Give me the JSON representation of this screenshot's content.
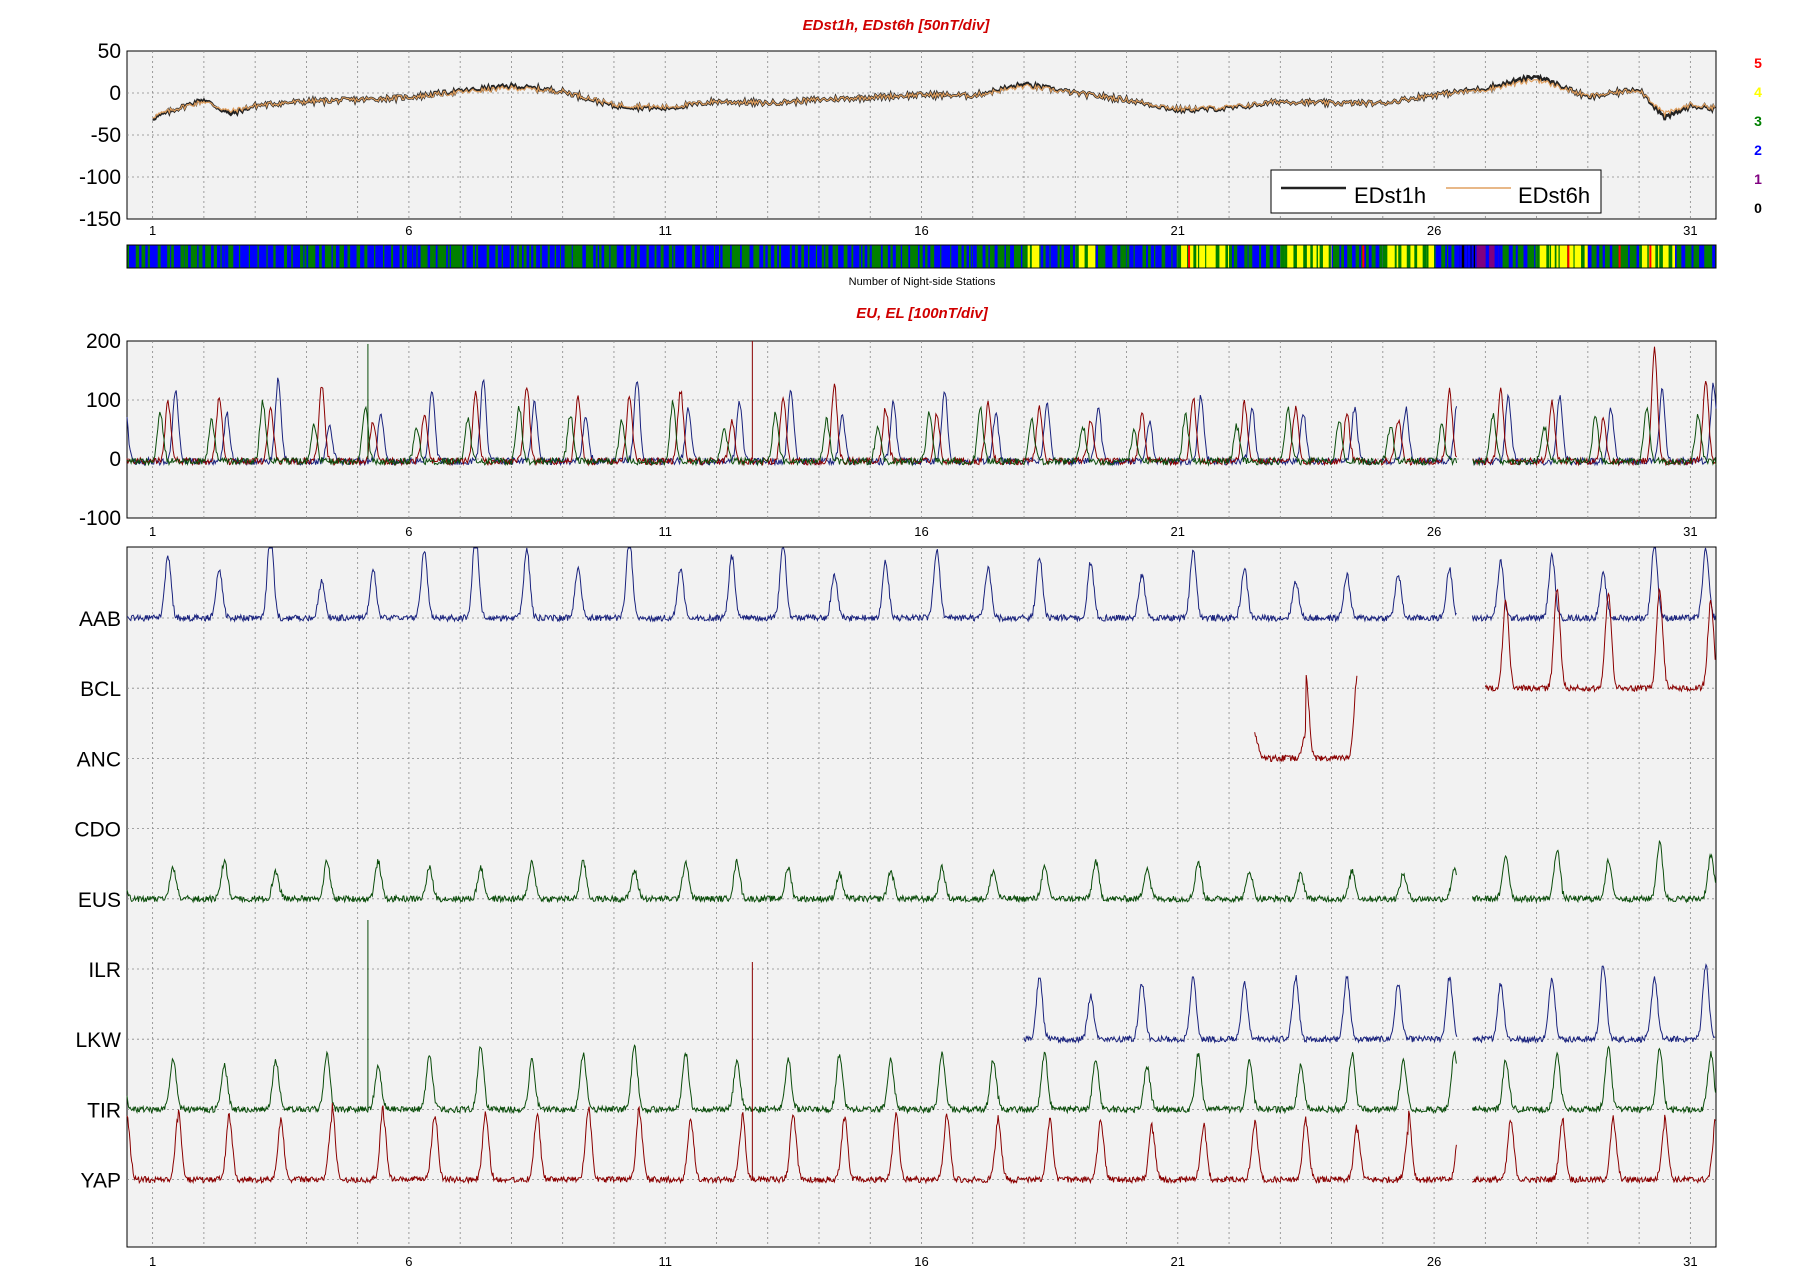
{
  "colors": {
    "navy": "#1a237e",
    "darkred": "#8b0000",
    "darkgreen": "#0b4d0b",
    "edst1h": "#222222",
    "edst6h": "#e0a060",
    "title": "#d00000",
    "count_0": "#000000",
    "count_1": "#800080",
    "count_2": "#0000ff",
    "count_3": "#008000",
    "count_4": "#ffff00",
    "count_5": "#ff0000"
  },
  "chart_data": [
    {
      "type": "line",
      "title": "EDst1h, EDst6h [50nT/div]",
      "ylim": [
        -150,
        50
      ],
      "yticks": [
        "50",
        "0",
        "-50",
        "-100",
        "-150"
      ],
      "xlim": [
        0.5,
        31.5
      ],
      "xticks": [
        "1",
        "6",
        "11",
        "16",
        "21",
        "26",
        "31"
      ],
      "grid": true,
      "legend_position": "bottom-right",
      "series": [
        {
          "name": "EDst1h",
          "color_key": "edst1h",
          "x": [
            1,
            1.5,
            2,
            2.5,
            3,
            3.5,
            4,
            5,
            6,
            7,
            8,
            9,
            10,
            11,
            12,
            13,
            14,
            15,
            16,
            17,
            18,
            19,
            20,
            21,
            22,
            23,
            24,
            25,
            26,
            27,
            28,
            29,
            30,
            30.5,
            31,
            31.5
          ],
          "y": [
            -30,
            -18,
            -8,
            -25,
            -15,
            -12,
            -10,
            -8,
            -5,
            2,
            8,
            2,
            -15,
            -18,
            -10,
            -12,
            -8,
            -5,
            -2,
            -3,
            10,
            0,
            -8,
            -20,
            -18,
            -10,
            -12,
            -12,
            -2,
            5,
            20,
            -5,
            5,
            -30,
            -15,
            -18
          ]
        },
        {
          "name": "EDst6h",
          "color_key": "edst6h",
          "x": [
            1,
            1.5,
            2,
            2.5,
            3,
            3.5,
            4,
            5,
            6,
            7,
            8,
            9,
            10,
            11,
            12,
            13,
            14,
            15,
            16,
            17,
            18,
            19,
            20,
            21,
            22,
            23,
            24,
            25,
            26,
            27,
            28,
            29,
            30,
            30.5,
            31,
            31.5
          ],
          "y": [
            -28,
            -18,
            -10,
            -22,
            -15,
            -12,
            -10,
            -8,
            -5,
            1,
            6,
            2,
            -14,
            -17,
            -10,
            -12,
            -8,
            -5,
            -2,
            -3,
            8,
            0,
            -8,
            -19,
            -17,
            -10,
            -12,
            -12,
            -2,
            4,
            16,
            -4,
            4,
            -25,
            -14,
            -17
          ]
        }
      ]
    },
    {
      "type": "heatmap",
      "xlabel": "Number of Night-side Stations",
      "colorbar_labels": [
        "5",
        "4",
        "3",
        "2",
        "1",
        "0"
      ],
      "xlim": [
        0.5,
        31.5
      ],
      "segments": [
        {
          "x0": 0.5,
          "x1": 2,
          "count": 2
        },
        {
          "x0": 2,
          "x1": 2.5,
          "count": 3
        },
        {
          "x0": 2.5,
          "x1": 4,
          "count": 2
        },
        {
          "x0": 4,
          "x1": 4.8,
          "count": 3
        },
        {
          "x0": 4.8,
          "x1": 6,
          "count": 2
        },
        {
          "x0": 6,
          "x1": 7,
          "count": 3
        },
        {
          "x0": 7,
          "x1": 9,
          "count": 2
        },
        {
          "x0": 9,
          "x1": 10,
          "count": 3
        },
        {
          "x0": 10,
          "x1": 12,
          "count": 2
        },
        {
          "x0": 12,
          "x1": 13,
          "count": 3
        },
        {
          "x0": 13,
          "x1": 15,
          "count": 2
        },
        {
          "x0": 15,
          "x1": 16,
          "count": 3
        },
        {
          "x0": 16,
          "x1": 17,
          "count": 2
        },
        {
          "x0": 17,
          "x1": 18,
          "count": 3
        },
        {
          "x0": 18,
          "x1": 18.3,
          "count": 4
        },
        {
          "x0": 18.3,
          "x1": 19,
          "count": 2
        },
        {
          "x0": 19,
          "x1": 19.4,
          "count": 4
        },
        {
          "x0": 19.4,
          "x1": 20,
          "count": 3
        },
        {
          "x0": 20,
          "x1": 21,
          "count": 2
        },
        {
          "x0": 21,
          "x1": 22,
          "count": 4
        },
        {
          "x0": 22,
          "x1": 23,
          "count": 2
        },
        {
          "x0": 23,
          "x1": 24,
          "count": 4
        },
        {
          "x0": 24,
          "x1": 25,
          "count": 3
        },
        {
          "x0": 25,
          "x1": 26,
          "count": 4
        },
        {
          "x0": 26,
          "x1": 26.5,
          "count": 2
        },
        {
          "x0": 26.5,
          "x1": 26.8,
          "count": 0
        },
        {
          "x0": 26.8,
          "x1": 27.3,
          "count": 1
        },
        {
          "x0": 27.3,
          "x1": 28,
          "count": 3
        },
        {
          "x0": 28,
          "x1": 29,
          "count": 4
        },
        {
          "x0": 29,
          "x1": 30,
          "count": 3
        },
        {
          "x0": 30,
          "x1": 30.7,
          "count": 4
        },
        {
          "x0": 30.7,
          "x1": 31.5,
          "count": 3
        }
      ]
    },
    {
      "type": "line",
      "title": "EU, EL   [100nT/div]",
      "ylim": [
        -100,
        200
      ],
      "yticks": [
        "200",
        "100",
        "0",
        "-100"
      ],
      "xlim": [
        0.5,
        31.5
      ],
      "xticks": [
        "1",
        "6",
        "11",
        "16",
        "21",
        "26",
        "31"
      ],
      "grid": true,
      "series_peak_values": [
        {
          "color_key": "navy",
          "peaks": [
            120,
            80,
            140,
            60,
            80,
            120,
            140,
            100,
            80,
            140,
            90,
            100,
            120,
            80,
            100,
            120,
            80,
            100,
            90,
            70,
            110,
            90,
            80,
            90,
            90,
            100,
            110,
            110,
            90,
            120,
            130,
            110
          ]
        },
        {
          "color_key": "darkred",
          "peaks": [
            100,
            110,
            90,
            130,
            70,
            80,
            120,
            130,
            110,
            110,
            120,
            70,
            110,
            130,
            90,
            80,
            100,
            90,
            70,
            80,
            110,
            100,
            90,
            80,
            70,
            120,
            120,
            100,
            70,
            190,
            140,
            200
          ]
        },
        {
          "color_key": "darkgreen",
          "peaks": [
            80,
            70,
            100,
            60,
            90,
            60,
            70,
            90,
            80,
            70,
            100,
            60,
            80,
            70,
            60,
            80,
            90,
            70,
            60,
            50,
            80,
            60,
            90,
            70,
            60,
            60,
            80,
            60,
            80,
            90,
            80,
            90
          ]
        }
      ]
    },
    {
      "type": "line",
      "title": "",
      "xlim": [
        0.5,
        31.5
      ],
      "xticks": [
        "1",
        "6",
        "11",
        "16",
        "21",
        "26",
        "31"
      ],
      "grid": true,
      "stations": [
        {
          "name": "AAB",
          "color_key": "navy",
          "x_start": 0.5,
          "x_end": 31.5,
          "amplitude": 100,
          "peaks": [
            100,
            80,
            140,
            60,
            80,
            110,
            140,
            110,
            80,
            130,
            80,
            100,
            120,
            70,
            90,
            110,
            80,
            100,
            90,
            70,
            110,
            80,
            60,
            70,
            70,
            80,
            90,
            100,
            70,
            120,
            110,
            130
          ]
        },
        {
          "name": "BCL",
          "color_key": "darkred",
          "x_start": 27,
          "x_end": 31.5,
          "amplitude": 100,
          "peaks": [
            140,
            160,
            150,
            160,
            140
          ]
        },
        {
          "name": "ANC",
          "color_key": "darkred",
          "x_start": 22.5,
          "x_end": 24.5,
          "amplitude": 100,
          "peaks": [
            40,
            130
          ]
        },
        {
          "name": "CDO",
          "color_key": "darkgreen",
          "x_start": 0,
          "x_end": 0,
          "amplitude": 0,
          "peaks": []
        },
        {
          "name": "EUS",
          "color_key": "darkgreen",
          "x_start": 0.5,
          "x_end": 31.5,
          "amplitude": 100,
          "peaks": [
            50,
            60,
            45,
            60,
            60,
            50,
            50,
            60,
            60,
            45,
            60,
            60,
            50,
            40,
            45,
            50,
            45,
            50,
            60,
            50,
            60,
            45,
            40,
            45,
            40,
            50,
            70,
            80,
            60,
            90,
            70,
            75
          ]
        },
        {
          "name": "ILR",
          "color_key": "navy",
          "x_start": 0,
          "x_end": 0,
          "amplitude": 0,
          "peaks": []
        },
        {
          "name": "LKW",
          "color_key": "navy",
          "x_start": 18,
          "x_end": 31.5,
          "amplitude": 100,
          "peaks": [
            100,
            70,
            90,
            100,
            90,
            100,
            100,
            90,
            100,
            90,
            100,
            120,
            100,
            120
          ]
        },
        {
          "name": "TIR",
          "color_key": "darkgreen",
          "x_start": 0.5,
          "x_end": 31.5,
          "amplitude": 100,
          "peaks": [
            80,
            70,
            80,
            90,
            70,
            90,
            100,
            80,
            90,
            100,
            90,
            80,
            80,
            90,
            80,
            90,
            80,
            90,
            80,
            70,
            90,
            80,
            70,
            90,
            80,
            90,
            80,
            90,
            100,
            100,
            90,
            100
          ]
        },
        {
          "name": "YAP",
          "color_key": "darkred",
          "x_start": 0.5,
          "x_end": 31.5,
          "amplitude": 100,
          "peaks": [
            100,
            110,
            90,
            100,
            120,
            100,
            110,
            100,
            110,
            120,
            100,
            90,
            110,
            100,
            100,
            110,
            100,
            90,
            100,
            90,
            80,
            90,
            100,
            90,
            80,
            110,
            100,
            90,
            100,
            90,
            100,
            110
          ]
        }
      ]
    }
  ]
}
